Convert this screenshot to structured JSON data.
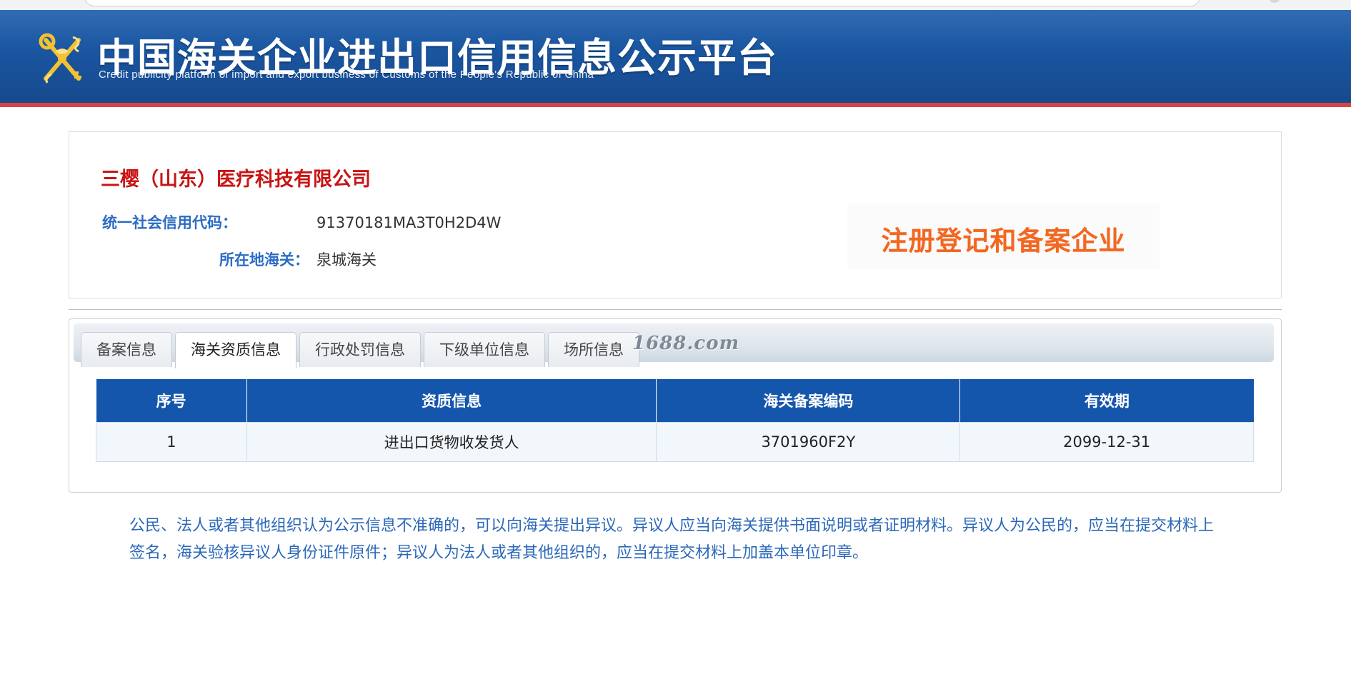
{
  "header": {
    "title": "中国海关企业进出口信用信息公示平台",
    "subtitle": "Credit publicity platform of import and export business of Customs of the People's Republic of China"
  },
  "company": {
    "name": "三樱（山东）医疗科技有限公司",
    "credit_code_label": "统一社会信用代码：",
    "credit_code": "91370181MA3T0H2D4W",
    "customs_label": "所在地海关：",
    "customs": "泉城海关",
    "badge": "注册登记和备案企业"
  },
  "tabs": [
    {
      "label": "备案信息",
      "active": false
    },
    {
      "label": "海关资质信息",
      "active": true
    },
    {
      "label": "行政处罚信息",
      "active": false
    },
    {
      "label": "下级单位信息",
      "active": false
    },
    {
      "label": "场所信息",
      "active": false
    }
  ],
  "watermark": "1688.com",
  "table": {
    "headers": [
      "序号",
      "资质信息",
      "海关备案编码",
      "有效期"
    ],
    "rows": [
      [
        "1",
        "进出口货物收发货人",
        "3701960F2Y",
        "2099-12-31"
      ]
    ]
  },
  "notice": "公民、法人或者其他组织认为公示信息不准确的，可以向海关提出异议。异议人应当向海关提供书面说明或者证明材料。异议人为公民的，应当在提交材料上签名，海关验核异议人身份证件原件；异议人为法人或者其他组织的，应当在提交材料上加盖本单位印章。",
  "colors": {
    "header_blue": "#1a55a0",
    "header_red_line": "#d64545",
    "company_name_red": "#c81414",
    "label_blue": "#2b6cc4",
    "badge_orange": "#f26722",
    "table_header_blue": "#1556ad",
    "notice_blue": "#2b68b8"
  },
  "icons": {
    "emblem": "customs-emblem-icon"
  }
}
